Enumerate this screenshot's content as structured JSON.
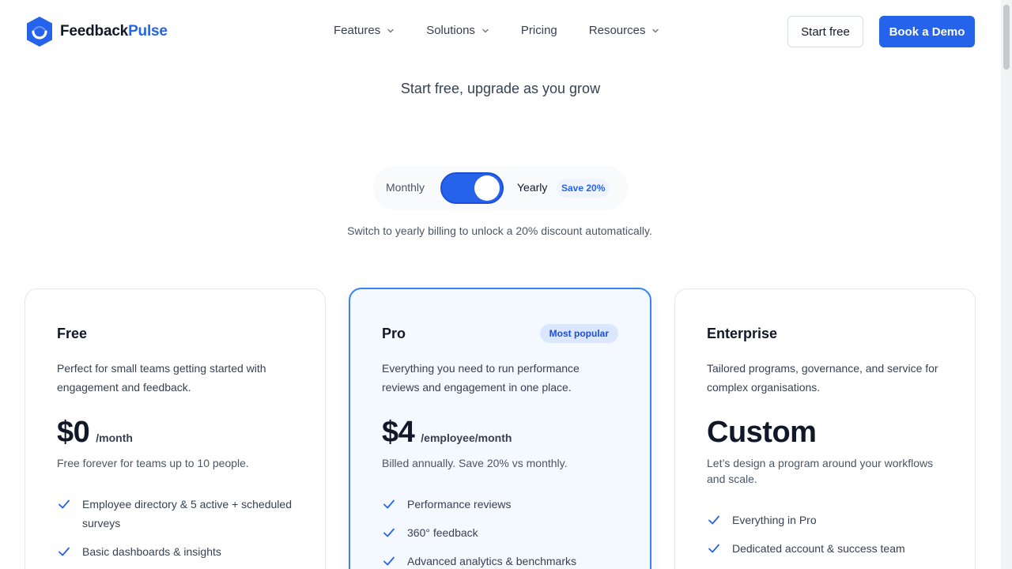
{
  "brand": {
    "name_part1": "Feedback",
    "name_part2": "Pulse",
    "primary_color": "#2563eb"
  },
  "nav": {
    "items": [
      {
        "label": "Features",
        "has_dropdown": true
      },
      {
        "label": "Solutions",
        "has_dropdown": true
      },
      {
        "label": "Pricing",
        "has_dropdown": false
      },
      {
        "label": "Resources",
        "has_dropdown": true
      }
    ]
  },
  "header_actions": {
    "start_free": "Start free",
    "book_demo": "Book a Demo"
  },
  "hero": {
    "subtitle": "Start free, upgrade as you grow"
  },
  "billing_toggle": {
    "monthly_label": "Monthly",
    "yearly_label": "Yearly",
    "save_badge": "Save 20%",
    "selected": "Yearly",
    "hint": "Switch to yearly billing to unlock a 20% discount automatically."
  },
  "plans": [
    {
      "name": "Free",
      "description": "Perfect for small teams getting started with engagement and feedback.",
      "price": "$0",
      "price_unit": "/month",
      "price_note": "Free forever for teams up to 10 people.",
      "features": [
        "Employee directory & 5 active + scheduled surveys",
        "Basic dashboards & insights"
      ]
    },
    {
      "name": "Pro",
      "badge": "Most popular",
      "description": "Everything you need to run performance reviews and engagement in one place.",
      "price": "$4",
      "price_unit": "/employee/month",
      "price_note": "Billed annually. Save 20% vs monthly.",
      "features": [
        "Performance reviews",
        "360° feedback",
        "Advanced analytics & benchmarks"
      ]
    },
    {
      "name": "Enterprise",
      "description": "Tailored programs, governance, and service for complex organisations.",
      "price": "Custom",
      "price_unit": "",
      "price_note": "Let’s design a program around your workflows and scale.",
      "features": [
        "Everything in Pro",
        "Dedicated account & success team"
      ]
    }
  ]
}
